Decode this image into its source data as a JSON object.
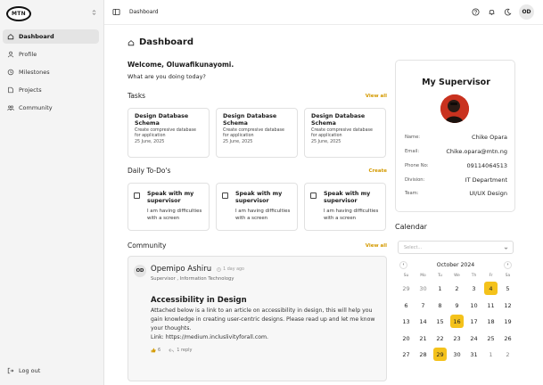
{
  "brand": {
    "logo_text": "MTN",
    "chevron": "⌃\n⌄"
  },
  "sidebar": {
    "items": [
      {
        "label": "Dashboard",
        "icon": "home-icon",
        "active": true
      },
      {
        "label": "Profile",
        "icon": "user-icon",
        "active": false
      },
      {
        "label": "Milestones",
        "icon": "milestone-icon",
        "active": false
      },
      {
        "label": "Projects",
        "icon": "folder-icon",
        "active": false
      },
      {
        "label": "Community",
        "icon": "community-icon",
        "active": false
      }
    ],
    "logout_label": "Log out"
  },
  "topbar": {
    "breadcrumb": "Dashboard",
    "avatar_initials": "OD"
  },
  "main": {
    "page_title": "Dashboard",
    "welcome": "Welcome, Oluwafikunayomi.",
    "subtitle": "What are you doing today?",
    "tasks": {
      "title": "Tasks",
      "link": "View all",
      "items": [
        {
          "title": "Design Database Schema",
          "desc": "Create compresive database for application",
          "date": "25 June, 2025"
        },
        {
          "title": "Design Database Schema",
          "desc": "Create compresive database for application",
          "date": "25 June, 2025"
        },
        {
          "title": "Design Database Schema",
          "desc": "Create compresive database for application",
          "date": "25 June, 2025"
        }
      ]
    },
    "todos": {
      "title": "Daily To-Do's",
      "link": "Create",
      "items": [
        {
          "title": "Speak with my supervisor",
          "desc": "I am having difficulties with a screen"
        },
        {
          "title": "Speak with my supervisor",
          "desc": "I am having difficulties with a screen"
        },
        {
          "title": "Speak with my supervisor",
          "desc": "I am having difficulties with a screen"
        }
      ]
    },
    "community": {
      "title": "Community",
      "link": "View all",
      "post": {
        "avatar": "OD",
        "author": "Opemipo Ashiru",
        "time": "1 day ago",
        "role": "Supervisor , Information Technology",
        "heading": "Accessibility in Design",
        "body": "Attached below is a link to an article on accessibility in design, this will help you gain knowledge in creating user-centric designs. Please read up and let me know your thoughts.",
        "link": "Link: https://medium.incluslivityforall.com.",
        "likes": "6",
        "replies": "1 reply"
      }
    }
  },
  "supervisor": {
    "title": "My Supervisor",
    "fields": [
      {
        "label": "Name:",
        "value": "Chike Opara"
      },
      {
        "label": "Email:",
        "value": "Chike.opara@mtn.ng"
      },
      {
        "label": "Phone No:",
        "value": "09114064513"
      },
      {
        "label": "Division:",
        "value": "IT Department"
      },
      {
        "label": "Team:",
        "value": "UI/UX Design"
      }
    ]
  },
  "calendar": {
    "title": "Calendar",
    "select_placeholder": "Select...",
    "month": "October 2024",
    "prev": "‹",
    "next": "›",
    "weekdays": [
      "Su",
      "Mo",
      "Tu",
      "We",
      "Th",
      "Fr",
      "Sa"
    ],
    "weeks": [
      [
        "29",
        "30",
        "1",
        "2",
        "3",
        "4",
        "5"
      ],
      [
        "6",
        "7",
        "8",
        "9",
        "10",
        "11",
        "12"
      ],
      [
        "13",
        "14",
        "15",
        "16",
        "17",
        "18",
        "19"
      ],
      [
        "20",
        "21",
        "22",
        "23",
        "24",
        "25",
        "26"
      ],
      [
        "27",
        "28",
        "29",
        "30",
        "31",
        "1",
        "2"
      ]
    ],
    "highlighted": [
      "0-5",
      "2-3",
      "4-2"
    ],
    "muted": [
      "0-0",
      "0-1",
      "4-5",
      "4-6"
    ],
    "highlight_color": "#f4c21b"
  },
  "colors": {
    "accent": "#d49a00",
    "sidebar_bg": "#f4f4f4"
  }
}
